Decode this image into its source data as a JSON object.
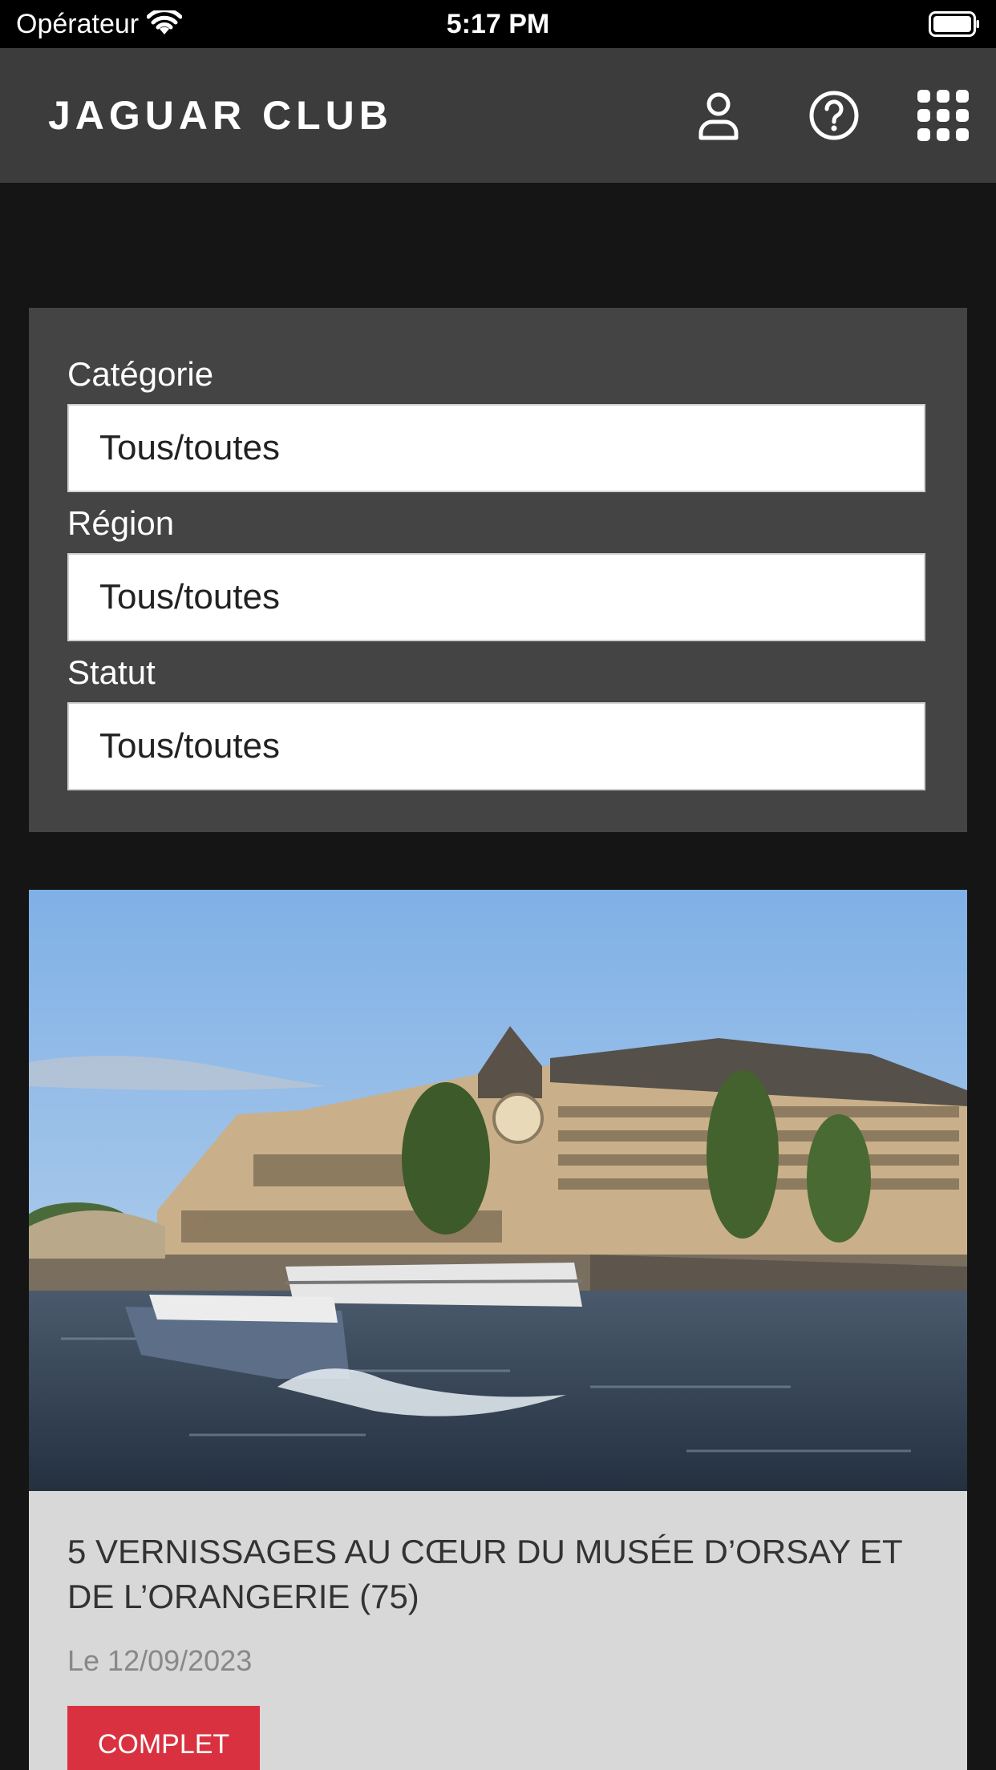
{
  "status_bar": {
    "carrier": "Opérateur",
    "time": "5:17 PM"
  },
  "header": {
    "brand": "JAGUAR CLUB",
    "icons": [
      "user-icon",
      "help-icon",
      "apps-grid-icon"
    ]
  },
  "filters": {
    "category": {
      "label": "Catégorie",
      "value": "Tous/toutes"
    },
    "region": {
      "label": "Région",
      "value": "Tous/toutes"
    },
    "status": {
      "label": "Statut",
      "value": "Tous/toutes"
    }
  },
  "events": [
    {
      "title": "5 VERNISSAGES AU CŒUR DU MUSÉE D’ORSAY ET DE L’ORANGERIE (75)",
      "date": "Le 12/09/2023",
      "status_badge": "COMPLET"
    }
  ],
  "colors": {
    "background": "#151515",
    "header": "#3c3c3c",
    "panel": "#444444",
    "card": "#d8d8d8",
    "badge": "#d9313f"
  }
}
